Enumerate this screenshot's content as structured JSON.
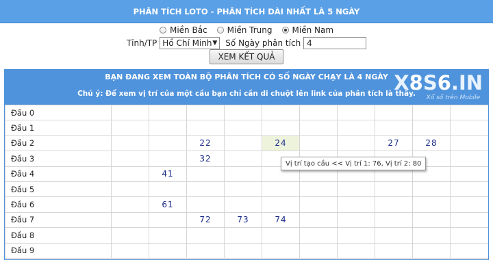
{
  "header": {
    "title": "PHÂN TÍCH LOTO - PHÂN TÍCH DÀI NHẤT LÀ 5 NGÀY"
  },
  "regions": [
    {
      "label": "Miền Bắc",
      "selected": false
    },
    {
      "label": "Miền Trung",
      "selected": false
    },
    {
      "label": "Miền Nam",
      "selected": true
    }
  ],
  "form": {
    "province_label": "Tỉnh/TP",
    "province_value": "Hồ Chí Minh",
    "days_label": "Số Ngày phân tích",
    "days_value": "4",
    "submit_label": "XEM KẾT QUẢ"
  },
  "panel": {
    "title": "BẠN ĐANG XEM TOÀN BỘ PHÂN TÍCH CÓ SỐ NGÀY CHẠY LÀ 4 NGÀY",
    "note": "Chú ý: Để xem vị trí của một cầu bạn chỉ cần di chuột lên link của phân tích là thấy.",
    "logo_text_a": "X",
    "logo_text_num1": "8",
    "logo_text_b": "S",
    "logo_text_num2": "6",
    "logo_text_c": ".IN",
    "logo_sub": "Xổ số trên Mobile"
  },
  "rows": [
    {
      "label": "Đầu 0",
      "cells": [
        "",
        "",
        "",
        "",
        "",
        "",
        "",
        "",
        "",
        ""
      ]
    },
    {
      "label": "Đầu 1",
      "cells": [
        "",
        "",
        "",
        "",
        "",
        "",
        "",
        "",
        "",
        ""
      ]
    },
    {
      "label": "Đầu 2",
      "cells": [
        "",
        "",
        "22",
        "",
        "24",
        "",
        "",
        "27",
        "28",
        ""
      ]
    },
    {
      "label": "Đầu 3",
      "cells": [
        "",
        "",
        "32",
        "",
        "",
        "",
        "",
        "",
        "",
        ""
      ]
    },
    {
      "label": "Đầu 4",
      "cells": [
        "",
        "41",
        "",
        "",
        "",
        "",
        "",
        "",
        "",
        ""
      ]
    },
    {
      "label": "Đầu 5",
      "cells": [
        "",
        "",
        "",
        "",
        "",
        "",
        "",
        "",
        "",
        ""
      ]
    },
    {
      "label": "Đầu 6",
      "cells": [
        "",
        "61",
        "",
        "",
        "",
        "",
        "",
        "",
        "",
        ""
      ]
    },
    {
      "label": "Đầu 7",
      "cells": [
        "",
        "",
        "72",
        "73",
        "74",
        "",
        "",
        "",
        "",
        ""
      ]
    },
    {
      "label": "Đầu 8",
      "cells": [
        "",
        "",
        "",
        "",
        "",
        "",
        "",
        "",
        "",
        ""
      ]
    },
    {
      "label": "Đầu 9",
      "cells": [
        "",
        "",
        "",
        "",
        "",
        "",
        "",
        "",
        "",
        ""
      ]
    }
  ],
  "highlight": {
    "row": 2,
    "col": 4
  },
  "tooltip": {
    "text": "Vị trí tạo cầu << Vị trí 1: 76, Vị trí 2: 80"
  }
}
